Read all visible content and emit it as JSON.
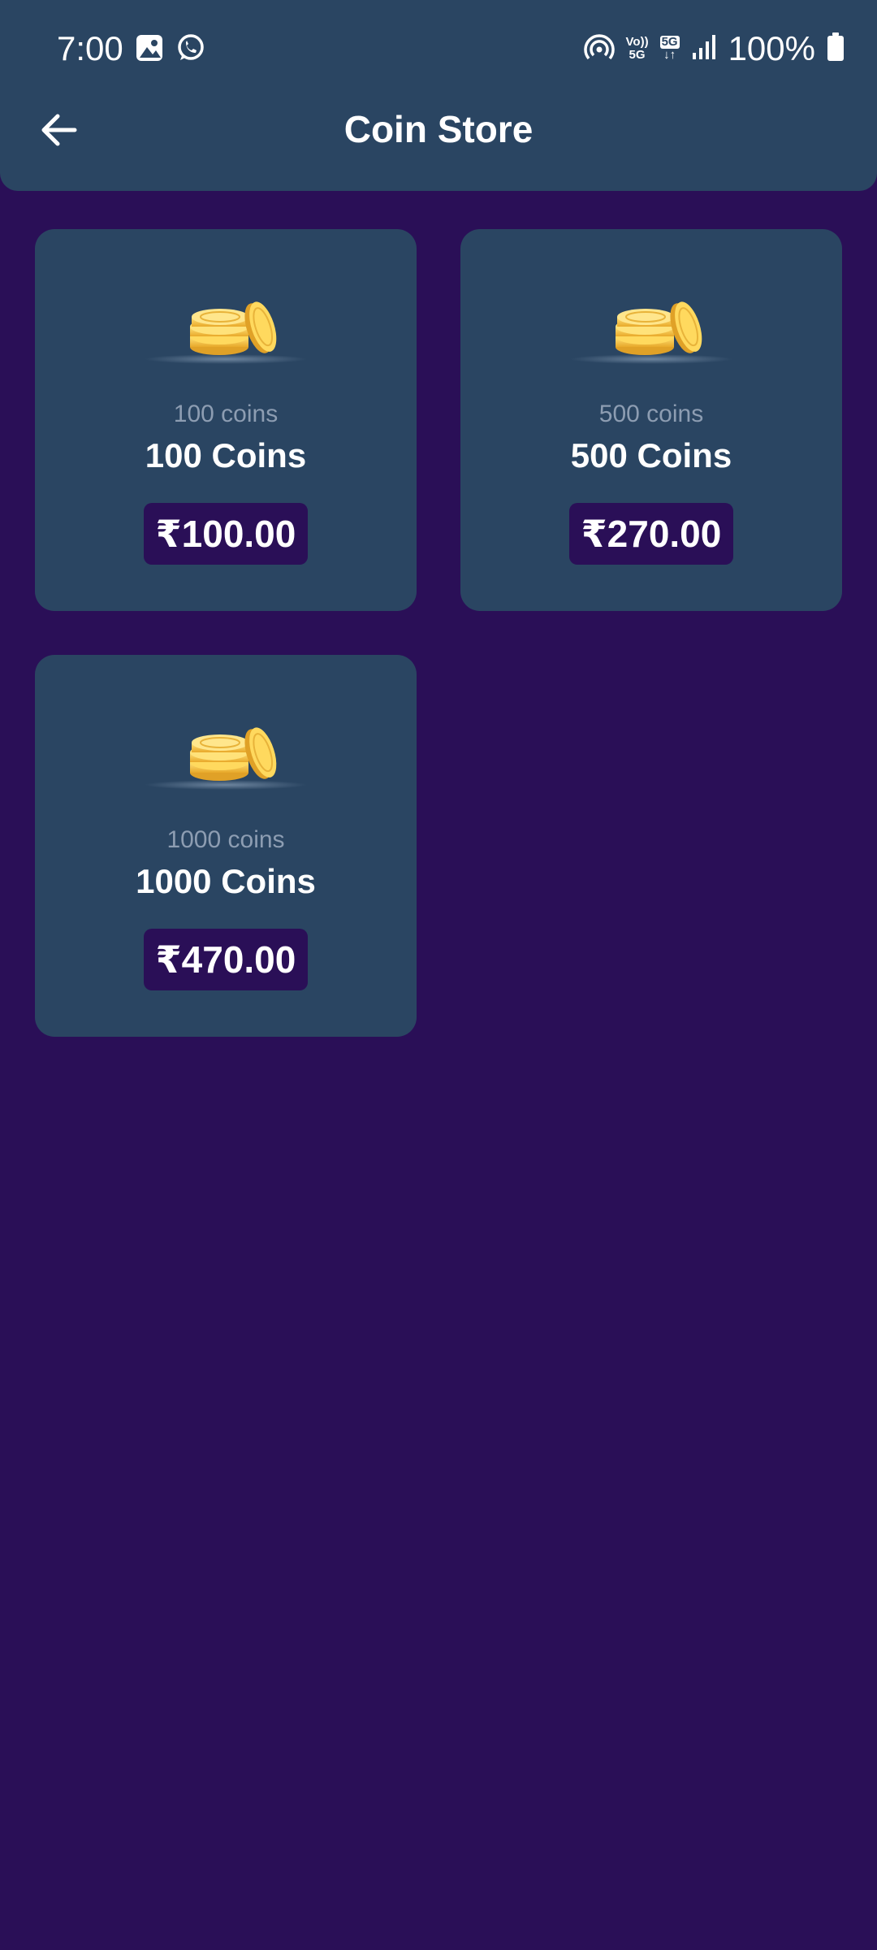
{
  "status_bar": {
    "time": "7:00",
    "battery_text": "100%",
    "net_top": "Vo))",
    "net_bottom": "5G",
    "net2_top": "5G",
    "net2_bottom": "↓↑"
  },
  "header": {
    "title": "Coin Store",
    "back_icon": "arrow-left-icon"
  },
  "packages": [
    {
      "subtitle": "100 coins",
      "title": "100 Coins",
      "price": "₹100.00"
    },
    {
      "subtitle": "500 coins",
      "title": "500 Coins",
      "price": "₹270.00"
    },
    {
      "subtitle": "1000 coins",
      "title": "1000 Coins",
      "price": "₹470.00"
    }
  ],
  "colors": {
    "background": "#2a0f57",
    "surface": "#2a4562",
    "muted_text": "#8d9db2",
    "coin_gold": "#f6c948"
  },
  "icons": {
    "status_left": [
      "gallery-icon",
      "whatsapp-icon"
    ],
    "status_right": [
      "hotspot-icon",
      "volte-5g-icon",
      "5g-data-icon",
      "signal-icon",
      "battery-icon"
    ],
    "card": "coin-stack-icon"
  }
}
